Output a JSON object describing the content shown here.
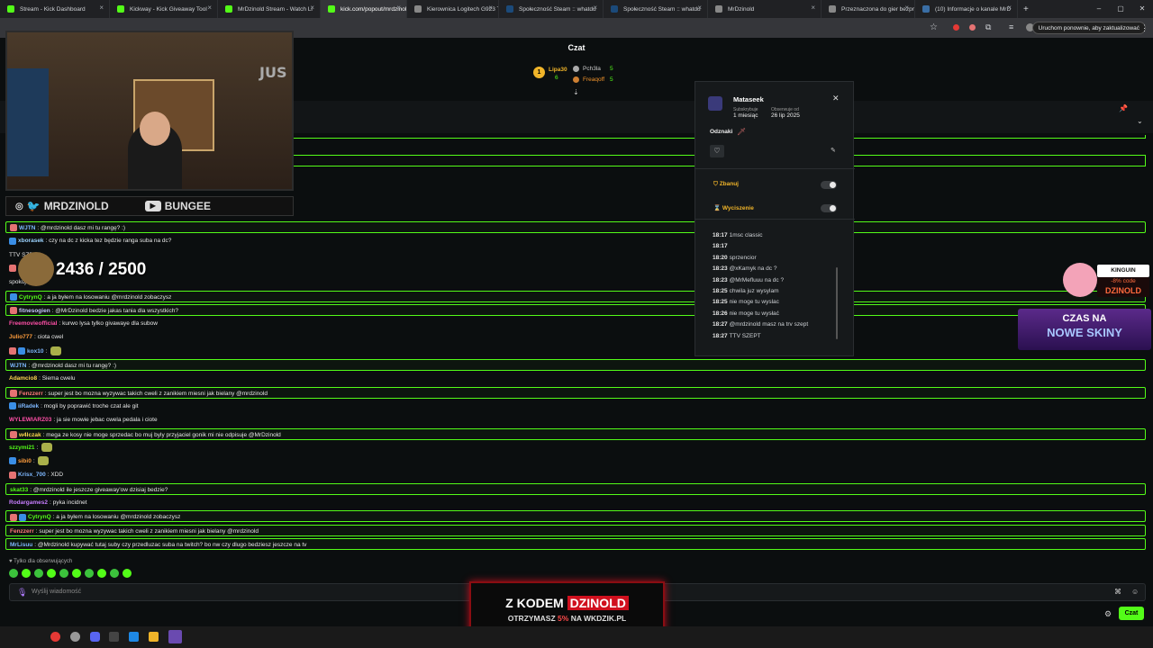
{
  "tabs": [
    {
      "label": "Stream - Kick Dashboard",
      "fav": "#53fc18",
      "active": false
    },
    {
      "label": "Kickway - Kick Giveaway Tool",
      "fav": "#53fc18",
      "active": false
    },
    {
      "label": "MrDzinold Stream - Watch Li",
      "fav": "#53fc18",
      "active": false
    },
    {
      "label": "kick.com/popout/mrdzinold/c",
      "fav": "#53fc18",
      "active": true
    },
    {
      "label": "Kierownica Logitech G923 TR",
      "fav": "#888888",
      "active": false
    },
    {
      "label": "Społeczność Steam :: whatdu",
      "fav": "#1b4a7a",
      "active": false
    },
    {
      "label": "Społeczność Steam :: whatdu",
      "fav": "#1b4a7a",
      "active": false
    },
    {
      "label": "MrDzinold",
      "fav": "#888888",
      "active": false
    },
    {
      "label": "Przeznaczona do gier bezprze",
      "fav": "#888888",
      "active": false
    },
    {
      "label": "(10) Informacje o kanale MrD",
      "fav": "#3a6ea5",
      "active": false
    }
  ],
  "browser": {
    "update_label": "Uruchom ponownie, aby zaktualizować"
  },
  "chat_header": {
    "title": "Czat"
  },
  "leaderboard": {
    "first": {
      "name": "Lipa30",
      "count": "6"
    },
    "entries": [
      {
        "name": "Pch3la",
        "count": "5"
      },
      {
        "name": "Freaqoff",
        "count": "5"
      }
    ]
  },
  "overlay": {
    "socials_handle": "MRDZINOLD",
    "youtube_handle": "BUNGEE",
    "counter": "2436 / 2500",
    "cam_text": "JUS"
  },
  "chat_lines": [
    {
      "user": "WJTN",
      "color": "#7eb8ff",
      "text": "@mrdzinold dasz mi tu rangę? :)",
      "hl": true
    },
    {
      "user": "xborasek",
      "color": "#9cd4ff",
      "text": "czy na dc z kicka tez będzie ranga suba na dc?",
      "hl": false
    },
    {
      "user": "",
      "color": "#ffffff",
      "text": "TTV SZEPT",
      "hl": false
    },
    {
      "user": "",
      "color": "#ffffff",
      "text": "",
      "hl": false
    },
    {
      "user": "",
      "color": "#ffffff",
      "text": "spokoj tu jest",
      "hl": false
    },
    {
      "user": "CytrynQ",
      "color": "#53fc18",
      "text": "a ja byłem na losowaniu @mrdzinold zobaczysz",
      "hl": true
    },
    {
      "user": "fitnesogien",
      "color": "#c7c7ff",
      "text": "@MrDzinold bedzie jakas tania  dla wszystkich?",
      "hl": true
    },
    {
      "user": "Freemovieofficial",
      "color": "#ff4fa7",
      "text": "kurwo lysa tylko givawaye dla subow",
      "hl": false
    },
    {
      "user": "Julio777",
      "color": "#ff9d3c",
      "text": "ciota cwel",
      "hl": false
    },
    {
      "user": "kox10",
      "color": "#7eb8ff",
      "text": "",
      "hl": false
    },
    {
      "user": "WJTN",
      "color": "#7eb8ff",
      "text": "@mrdzinold dasz mi tu rangę? :)",
      "hl": true
    },
    {
      "user": "Adamcio8",
      "color": "#ffd84f",
      "text": "Siema cwelu",
      "hl": false
    },
    {
      "user": "Fenzzerr",
      "color": "#ff7a7a",
      "text": "super jest bo mozna wyzywac takich cweli z zanikiem miesni jak bielany @mrdzinold",
      "hl": true
    },
    {
      "user": "iiRadek",
      "color": "#7eb8ff",
      "text": "mogli by poprawić troche czat ale git",
      "hl": false
    },
    {
      "user": "WYLEWIARZ03",
      "color": "#ff4fa7",
      "text": "ja sie mowie jebac cwela pedala i ciote",
      "hl": false
    },
    {
      "user": "w4lczak",
      "color": "#ffd84f",
      "text": "mega ze kosy nie moge sprzedac bo muj byly przyjaciel gonik mi nie odpisuje  @MrDzinold",
      "hl": true
    },
    {
      "user": "szzymi21",
      "color": "#53fc18",
      "text": "",
      "hl": false
    },
    {
      "user": "sibi0",
      "color": "#ff9d3c",
      "text": "",
      "hl": false
    },
    {
      "user": "Krisx_700",
      "color": "#7eb8ff",
      "text": "XDD",
      "hl": false
    },
    {
      "user": "skat33",
      "color": "#53fc18",
      "text": "@mrdzinold ile jeszcze giveaway'ow dzisiaj bedzie?",
      "hl": true
    },
    {
      "user": "Rodargames2",
      "color": "#c77dff",
      "text": "pyka incidnet",
      "hl": false
    },
    {
      "user": "CytrynQ",
      "color": "#53fc18",
      "text": "a ja byłem na losowaniu @mrdzinold zobaczysz",
      "hl": true
    },
    {
      "user": "Fenzzerr",
      "color": "#ff7a7a",
      "text": "super jest bo mozna wyzywac takich cweli z zanikiem miesni jak bielany @mrdzinold",
      "hl": true
    },
    {
      "user": "MrLisuu",
      "color": "#7eb8ff",
      "text": "@Mrdzinold kupywać tutaj suby czy przedluzac suba na twitch? bo nw czy dlugo bedziesz jeszcze na tv",
      "hl": true
    }
  ],
  "usercard": {
    "username": "Mataseek",
    "sub_label": "Subskrybuje",
    "sub_value": "1 miesiąc",
    "follow_label": "Obserwuje od",
    "follow_value": "26 lip 2025",
    "badges_label": "Odznaki",
    "ban_label": "Zbanuj",
    "timeout_label": "Wyciszenie",
    "history": [
      {
        "time": "18:17",
        "text": "1msc classic"
      },
      {
        "time": "18:17",
        "text": ""
      },
      {
        "time": "18:20",
        "text": "sprzencior"
      },
      {
        "time": "18:23",
        "text": "@xKamyk na dc ?"
      },
      {
        "time": "18:23",
        "text": "@MrMefluuu na dc ?"
      },
      {
        "time": "18:25",
        "text": "chwila juz wysylam"
      },
      {
        "time": "18:25",
        "text": "nie moge tu wyslac"
      },
      {
        "time": "18:26",
        "text": "nie moge tu wysłać"
      },
      {
        "time": "18:27",
        "text": "@mrdzinold masz na trv szept"
      },
      {
        "time": "18:27",
        "text": "TTV SZEPT"
      }
    ]
  },
  "right_overlay": {
    "kinguin_label": "KINGUIN",
    "kinguin_code_prefix": "-8% code",
    "kinguin_code": "DZINOLD",
    "skins_line1": "CZAS NA",
    "skins_line2": "NOWE SKINY"
  },
  "chat_footer": {
    "followers_only": "Tylko dla obserwujących",
    "placeholder": "Wyślij wiadomość",
    "send_label": "Czat"
  },
  "banner": {
    "line1_prefix": "Z KODEM",
    "line1_code": "DZINOLD",
    "line2_prefix": "OTRZYMASZ",
    "line2_percent": "5%",
    "line2_suffix": "NA WKDZIK.PL"
  }
}
